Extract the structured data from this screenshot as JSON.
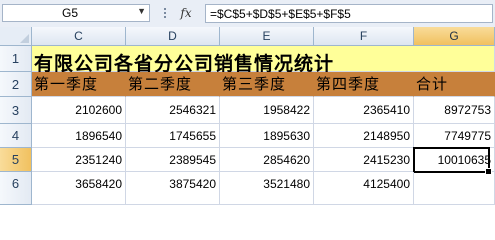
{
  "formula_bar": {
    "name_box": "G5",
    "fx_label": "fx",
    "formula": "=$C$5+$D$5+$E$5+$F$5"
  },
  "sheet": {
    "columns": [
      "C",
      "D",
      "E",
      "F",
      "G"
    ],
    "rows": [
      "1",
      "2",
      "3",
      "4",
      "5",
      "6"
    ],
    "selected_column": "G",
    "selected_row": "5",
    "title": "有限公司各省分公司销售情况统计",
    "headers": [
      "第一季度",
      "第二季度",
      "第三季度",
      "第四季度",
      "合计"
    ],
    "data": [
      [
        "2102600",
        "2546321",
        "1958422",
        "2365410",
        "8972753"
      ],
      [
        "1896540",
        "1745655",
        "1895630",
        "2148950",
        "7749775"
      ],
      [
        "2351240",
        "2389545",
        "2854620",
        "2415230",
        "10010635"
      ],
      [
        "3658420",
        "3875420",
        "3521480",
        "4125400",
        ""
      ]
    ],
    "colors": {
      "title_fill": "#ffff99",
      "header_fill": "#c7803b",
      "selection_header": "#f1c15f"
    }
  }
}
